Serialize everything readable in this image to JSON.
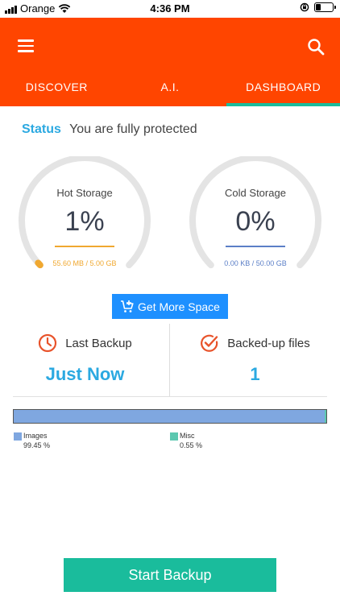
{
  "status_bar": {
    "carrier": "Orange",
    "time": "4:36 PM"
  },
  "tabs": [
    {
      "label": "DISCOVER"
    },
    {
      "label": "A.I."
    },
    {
      "label": "DASHBOARD",
      "active": true
    }
  ],
  "status": {
    "label": "Status",
    "text": "You are fully protected"
  },
  "gauges": {
    "hot": {
      "title": "Hot Storage",
      "value": "1%",
      "fraction": 0.01,
      "usage": "55.60 MB / 5.00 GB",
      "color": "#F0A830"
    },
    "cold": {
      "title": "Cold Storage",
      "value": "0%",
      "fraction": 0.0,
      "usage": "0.00 KB / 50.00 GB",
      "color": "#5B7FC7"
    }
  },
  "more_space_label": "Get More Space",
  "last_backup": {
    "label": "Last Backup",
    "value": "Just Now"
  },
  "backed_up_files": {
    "label": "Backed-up files",
    "value": "1"
  },
  "distribution": [
    {
      "name": "Images",
      "percent_label": "99.45 %",
      "fraction": 0.9945,
      "color": "#7FA7E0"
    },
    {
      "name": "Misc",
      "percent_label": "0.55 %",
      "fraction": 0.0055,
      "color": "#5CC8B0"
    }
  ],
  "start_backup_label": "Start Backup",
  "colors": {
    "brand": "#FF4500",
    "accent": "#1ABC9C",
    "link": "#2BA9E1",
    "button_blue": "#1E90FF"
  }
}
